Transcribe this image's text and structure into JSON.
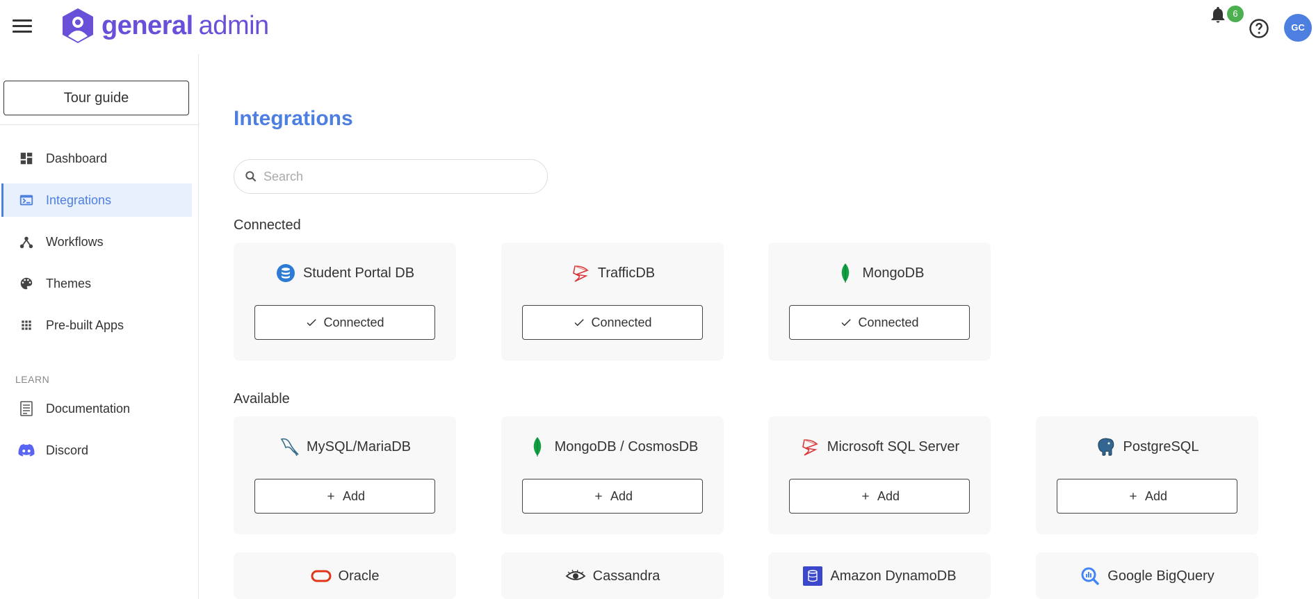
{
  "app": {
    "brand_bold": "general",
    "brand_light": "admin",
    "notification_count": "6",
    "user_initials": "GC"
  },
  "sidebar": {
    "tour_label": "Tour guide",
    "items": [
      {
        "label": "Dashboard",
        "icon": "dashboard-icon"
      },
      {
        "label": "Integrations",
        "icon": "terminal-window-icon",
        "active": true
      },
      {
        "label": "Workflows",
        "icon": "workflow-icon"
      },
      {
        "label": "Themes",
        "icon": "palette-icon"
      },
      {
        "label": "Pre-built Apps",
        "icon": "apps-grid-icon"
      }
    ],
    "learn_label": "LEARN",
    "learn_items": [
      {
        "label": "Documentation",
        "icon": "document-icon"
      },
      {
        "label": "Discord",
        "icon": "discord-icon"
      }
    ]
  },
  "main": {
    "title": "Integrations",
    "search_placeholder": "Search",
    "connected_label": "Connected",
    "available_label": "Available",
    "connected": [
      {
        "name": "Student Portal DB",
        "icon": "database-icon",
        "button": "Connected"
      },
      {
        "name": "TrafficDB",
        "icon": "sql-server-icon",
        "button": "Connected"
      },
      {
        "name": "MongoDB",
        "icon": "mongodb-leaf-icon",
        "button": "Connected"
      }
    ],
    "available": [
      {
        "name": "MySQL/MariaDB",
        "icon": "mysql-dolphin-icon",
        "button": "Add"
      },
      {
        "name": "MongoDB / CosmosDB",
        "icon": "mongodb-leaf-icon",
        "button": "Add"
      },
      {
        "name": "Microsoft SQL Server",
        "icon": "sql-server-icon",
        "button": "Add"
      },
      {
        "name": "PostgreSQL",
        "icon": "postgresql-elephant-icon",
        "button": "Add"
      },
      {
        "name": "Oracle",
        "icon": "oracle-icon"
      },
      {
        "name": "Cassandra",
        "icon": "cassandra-eye-icon"
      },
      {
        "name": "Amazon DynamoDB",
        "icon": "dynamodb-icon"
      },
      {
        "name": "Google BigQuery",
        "icon": "bigquery-icon"
      }
    ]
  },
  "colors": {
    "accent": "#4d7fe0",
    "brand": "#6a4fd8",
    "badge": "#4caf50",
    "active_bg": "#e8f0fd",
    "card_bg": "#f8f8f8"
  }
}
